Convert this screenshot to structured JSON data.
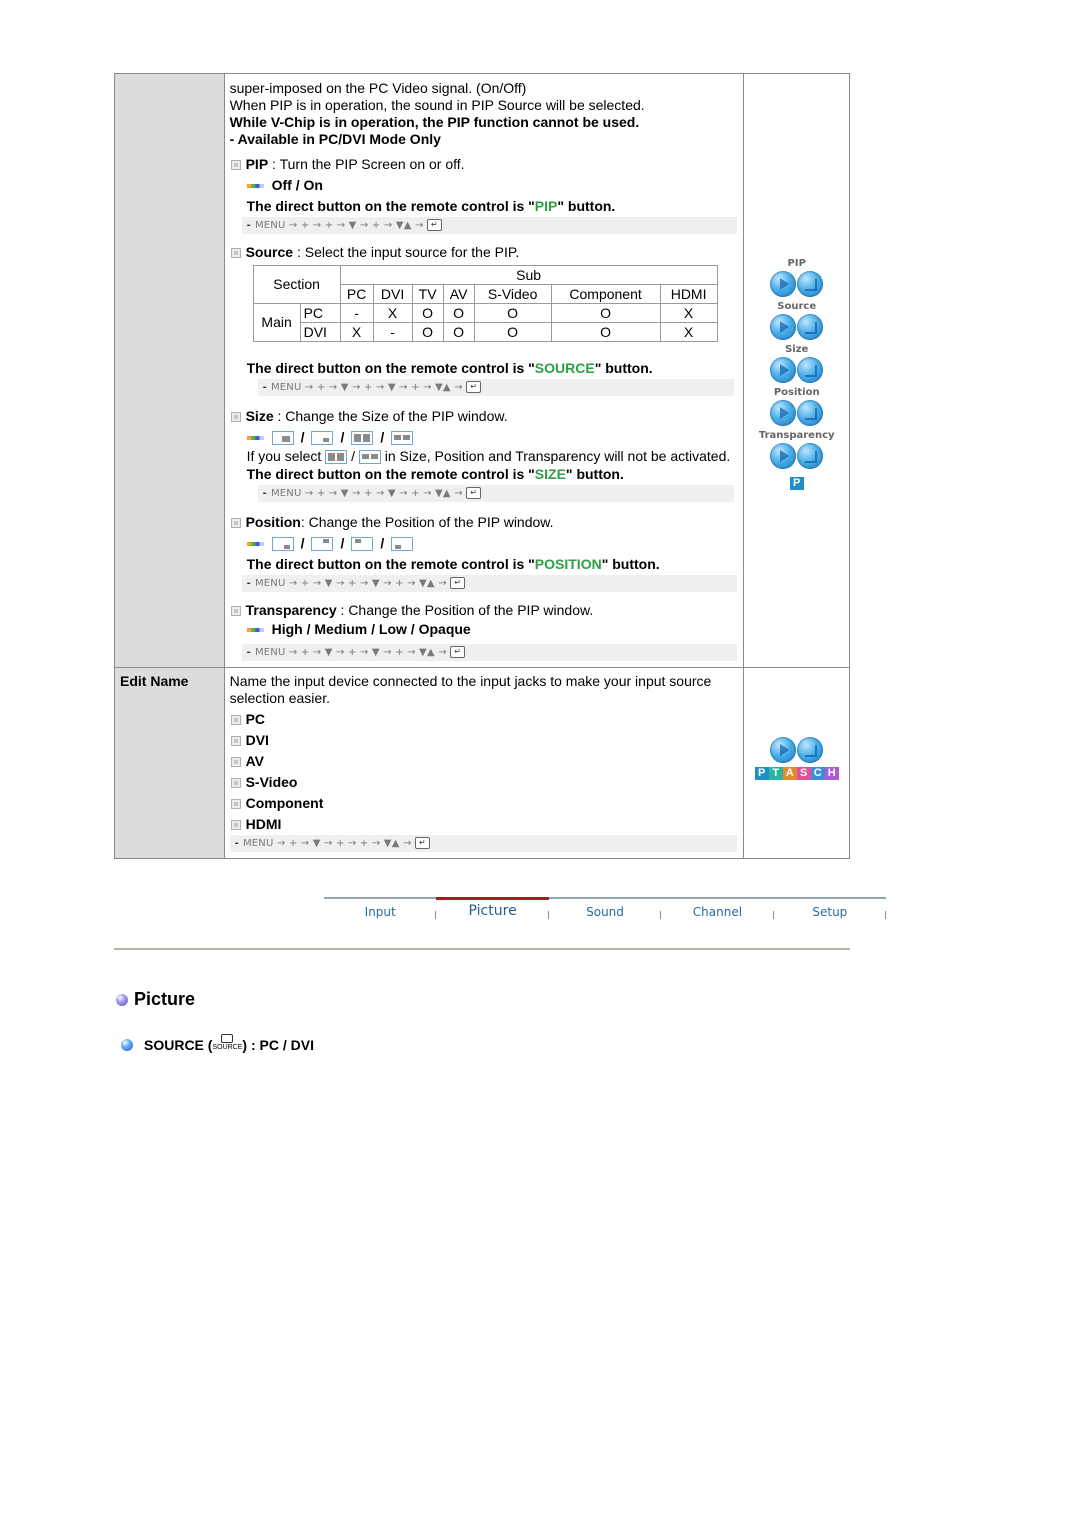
{
  "main_table": {
    "rows": [
      {
        "label": "",
        "intro": {
          "line1": "super-imposed on the PC Video signal. (On/Off)",
          "line2": "When PIP is in operation, the sound in PIP Source will be selected.",
          "line3": "While V-Chip is in operation, the PIP function cannot be used.",
          "line4": "- Available in PC/DVI Mode Only"
        },
        "items": {
          "pip": {
            "name": "PIP",
            "desc": " : Turn the PIP Screen on or off.",
            "options": "Off / On",
            "direct_prefix": "The direct button on the remote control is \"",
            "direct_button": "PIP",
            "direct_suffix": "\" button.",
            "menu_path": "MENU → + → + → ▼ → + → ▼▲ →"
          },
          "source": {
            "name": "Source",
            "desc": " : Select the input source for the PIP.",
            "table": {
              "section_header": "Section",
              "sub_header": "Sub",
              "sub_columns": [
                "PC",
                "DVI",
                "TV",
                "AV",
                "S-Video",
                "Component",
                "HDMI"
              ],
              "main_label": "Main",
              "rows": [
                {
                  "label": "PC",
                  "values": [
                    "-",
                    "X",
                    "O",
                    "O",
                    "O",
                    "O",
                    "X"
                  ]
                },
                {
                  "label": "DVI",
                  "values": [
                    "X",
                    "-",
                    "O",
                    "O",
                    "O",
                    "O",
                    "X"
                  ]
                }
              ]
            },
            "direct_prefix": "The direct button on the remote control is \"",
            "direct_button": "SOURCE",
            "direct_suffix": "\" button.",
            "menu_path": "MENU → + → ▼ → + → ▼ → + → ▼▲ →"
          },
          "size": {
            "name": "Size",
            "desc": " : Change the Size of the PIP window.",
            "note_prefix": "If you select",
            "note_suffix": "in Size, Position and Transparency will not be activated.",
            "direct_prefix": "The direct button on the remote control is \"",
            "direct_button": "SIZE",
            "direct_suffix": "\" button.",
            "menu_path": "MENU → + → ▼ → + → ▼ → + → ▼▲ →"
          },
          "position": {
            "name": "Position",
            "desc": ": Change the Position of the PIP window.",
            "direct_prefix": "The direct button on the remote control is \"",
            "direct_button": "POSITION",
            "direct_suffix": "\" button.",
            "menu_path": "MENU → + → ▼ → + → ▼ → + → ▼▲ →"
          },
          "transparency": {
            "name": "Transparency",
            "desc": " : Change the Position of the PIP window.",
            "options": "High / Medium / Low / Opaque",
            "menu_path": "MENU → + → ▼ → + → ▼ → + → ▼▲ →"
          }
        },
        "side_icons": [
          "PIP",
          "Source",
          "Size",
          "Position",
          "Transparency"
        ],
        "side_badge": "P"
      },
      {
        "label": "Edit Name",
        "intro": "Name the input device connected to the input jacks to make your input source selection easier.",
        "list": [
          "PC",
          "DVI",
          "AV",
          "S-Video",
          "Component",
          "HDMI"
        ],
        "menu_path": "MENU → + → ▼ → + → + → ▼▲ →",
        "side_badge_letters": [
          {
            "letter": "P",
            "color": "#1e90c9"
          },
          {
            "letter": "T",
            "color": "#2bb3a3"
          },
          {
            "letter": "A",
            "color": "#e58a2b"
          },
          {
            "letter": "S",
            "color": "#e0509a"
          },
          {
            "letter": "C",
            "color": "#3a8fd6"
          },
          {
            "letter": "H",
            "color": "#b05bd6"
          }
        ]
      }
    ]
  },
  "nav": {
    "items": [
      "Input",
      "Picture",
      "Sound",
      "Channel",
      "Setup"
    ],
    "active": "Picture"
  },
  "section": {
    "title": "Picture",
    "subtitle_prefix": "SOURCE (",
    "subtitle_key": "SOURCE",
    "subtitle_suffix": ") : PC / DVI"
  },
  "icons": {
    "enter_key": "↵"
  }
}
